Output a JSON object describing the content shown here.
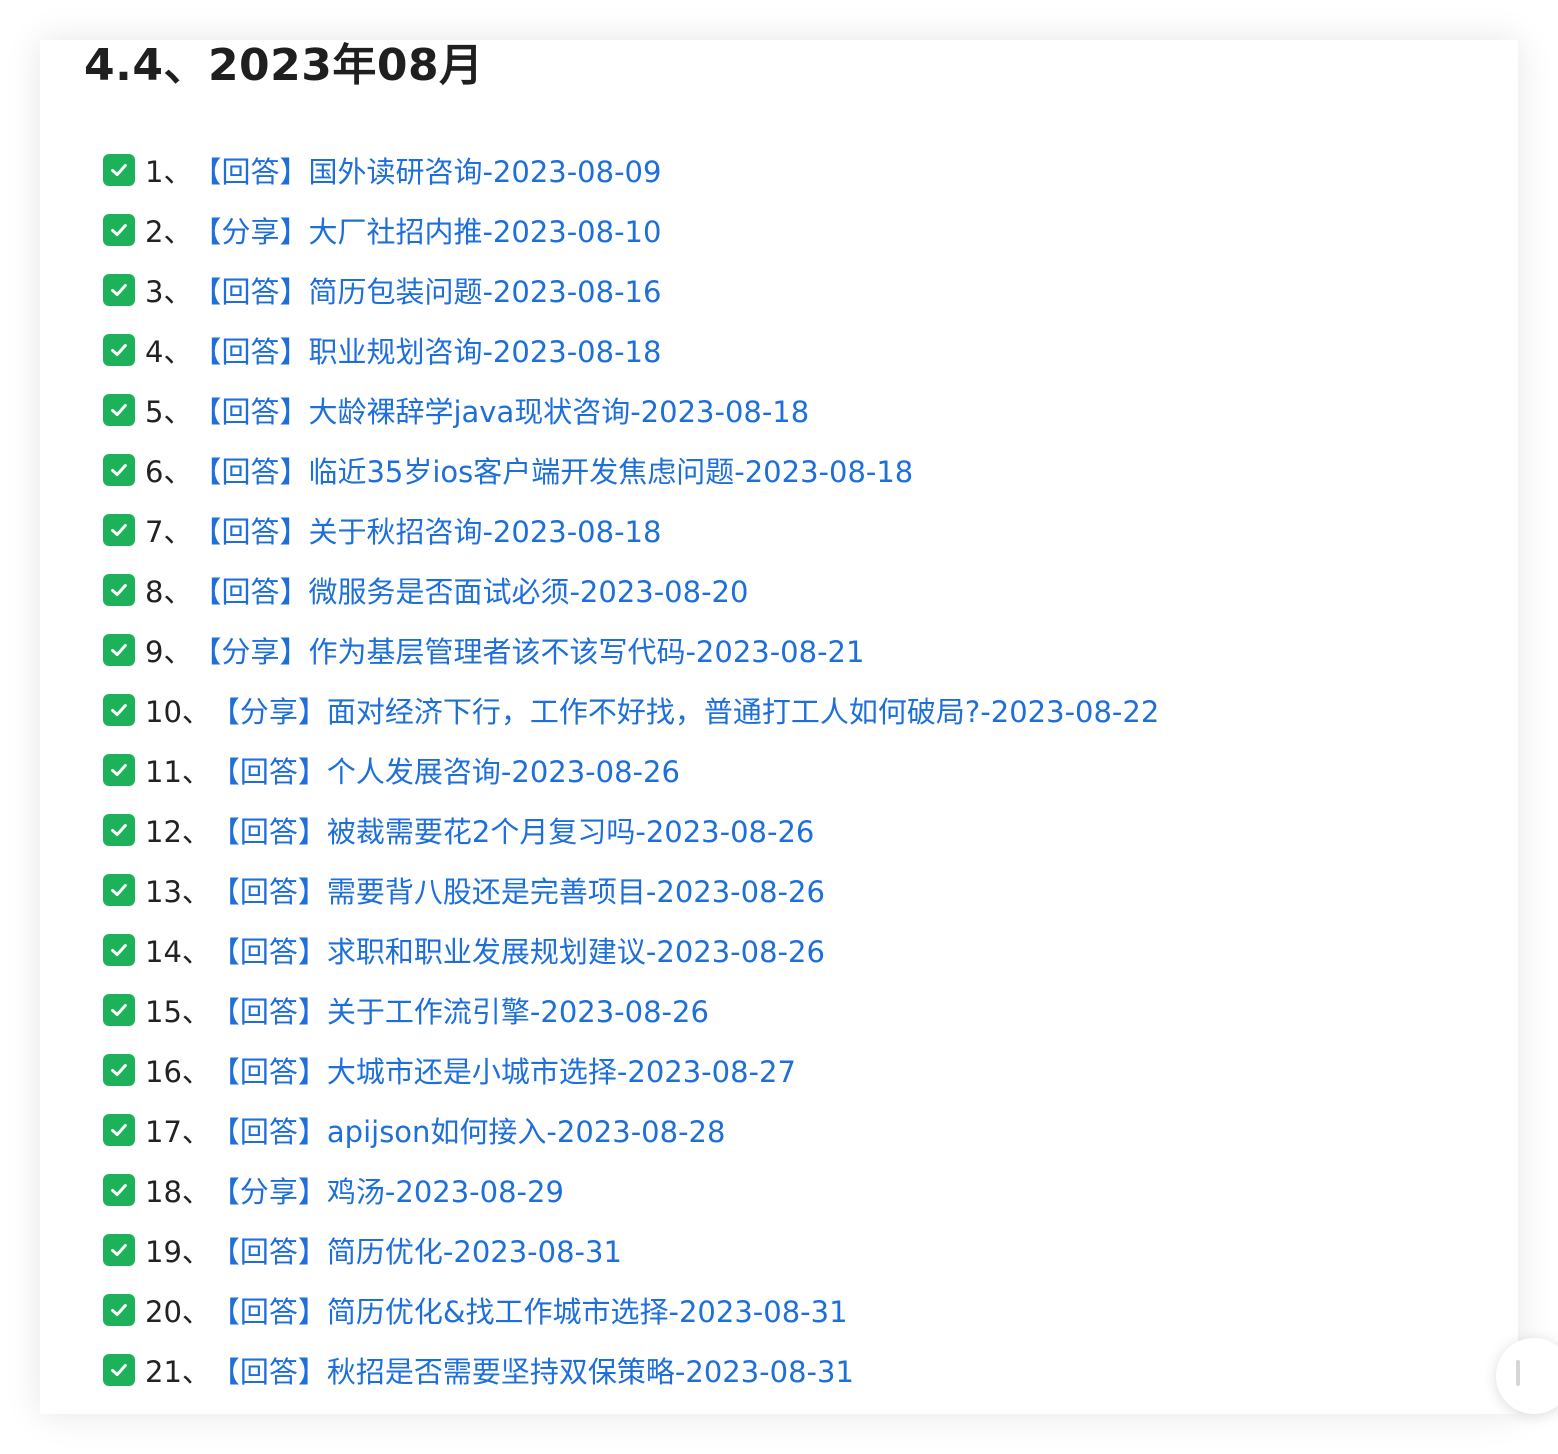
{
  "section": {
    "title": "4.4、2023年08月"
  },
  "items": [
    {
      "num": "1、",
      "text": "【回答】国外读研咨询-2023-08-09"
    },
    {
      "num": "2、",
      "text": "【分享】大厂社招内推-2023-08-10"
    },
    {
      "num": "3、",
      "text": "【回答】简历包装问题-2023-08-16"
    },
    {
      "num": "4、",
      "text": "【回答】职业规划咨询-2023-08-18"
    },
    {
      "num": "5、",
      "text": "【回答】大龄裸辞学java现状咨询-2023-08-18"
    },
    {
      "num": "6、",
      "text": "【回答】临近35岁ios客户端开发焦虑问题-2023-08-18"
    },
    {
      "num": "7、",
      "text": "【回答】关于秋招咨询-2023-08-18"
    },
    {
      "num": "8、",
      "text": "【回答】微服务是否面试必须-2023-08-20"
    },
    {
      "num": "9、",
      "text": "【分享】作为基层管理者该不该写代码-2023-08-21"
    },
    {
      "num": "10、",
      "text": "【分享】面对经济下行，工作不好找，普通打工人如何破局?-2023-08-22"
    },
    {
      "num": "11、",
      "text": "【回答】个人发展咨询-2023-08-26"
    },
    {
      "num": "12、",
      "text": "【回答】被裁需要花2个月复习吗-2023-08-26"
    },
    {
      "num": "13、",
      "text": "【回答】需要背八股还是完善项目-2023-08-26"
    },
    {
      "num": "14、",
      "text": "【回答】求职和职业发展规划建议-2023-08-26"
    },
    {
      "num": "15、",
      "text": "【回答】关于工作流引擎-2023-08-26"
    },
    {
      "num": "16、",
      "text": "【回答】大城市还是小城市选择-2023-08-27"
    },
    {
      "num": "17、",
      "text": "【回答】apijson如何接入-2023-08-28"
    },
    {
      "num": "18、",
      "text": "【分享】鸡汤-2023-08-29"
    },
    {
      "num": "19、",
      "text": "【回答】简历优化-2023-08-31"
    },
    {
      "num": "20、",
      "text": "【回答】简历优化&找工作城市选择-2023-08-31"
    },
    {
      "num": "21、",
      "text": "【回答】秋招是否需要坚持双保策略-2023-08-31"
    }
  ],
  "colors": {
    "check": "#1db25a",
    "link": "#1e6fd9",
    "text": "#222222"
  },
  "icons": {
    "item_checkbox": "check-square-icon"
  }
}
